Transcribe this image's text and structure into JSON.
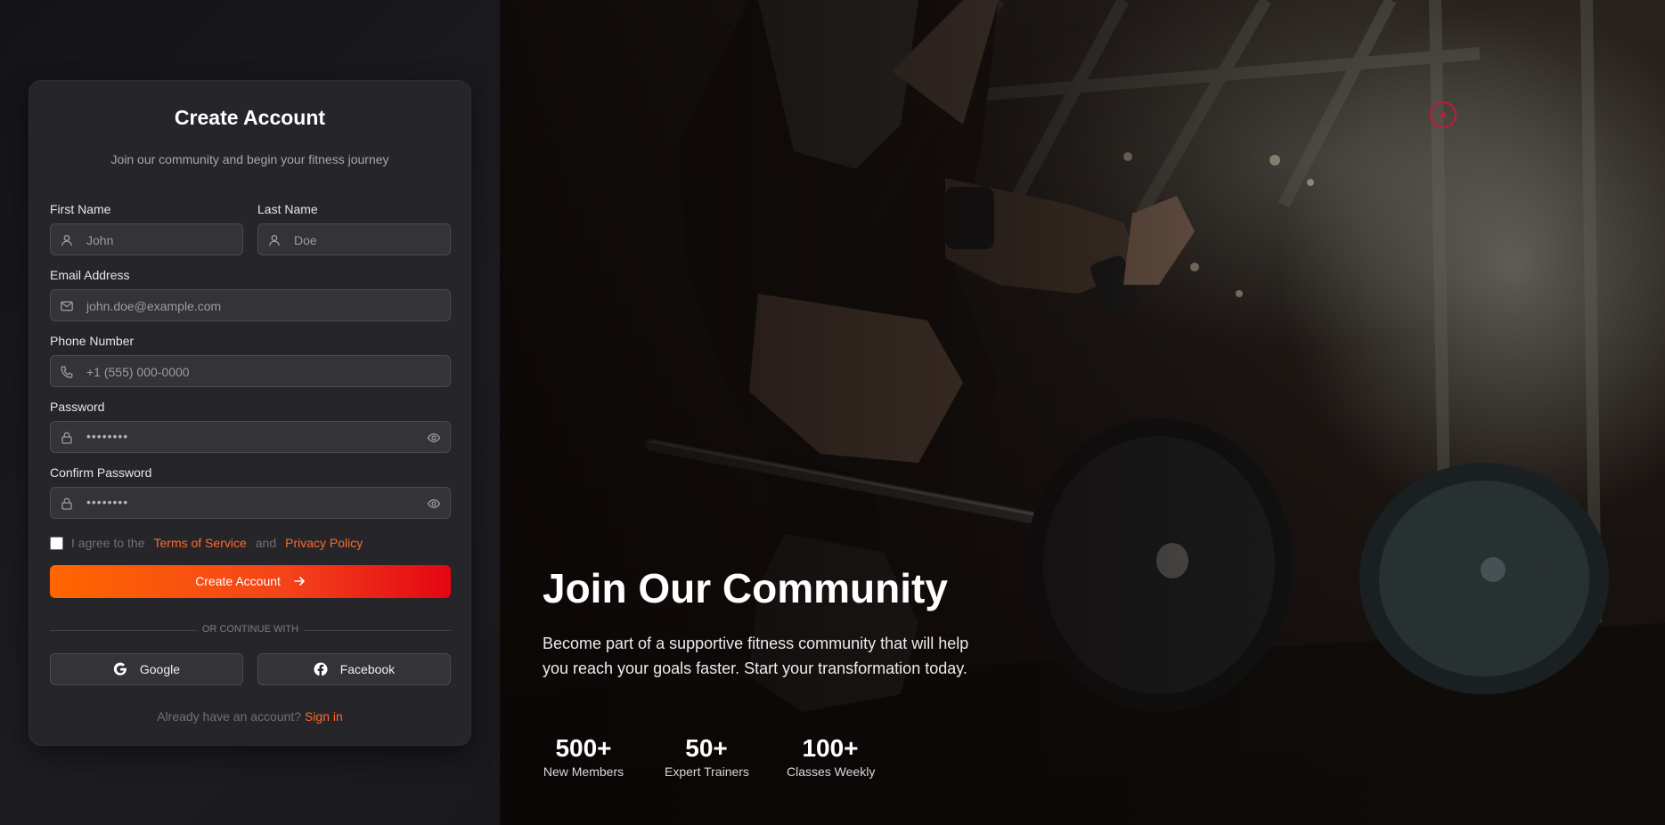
{
  "form": {
    "title": "Create Account",
    "subtitle": "Join our community and begin your fitness journey",
    "first_name": {
      "label": "First Name",
      "placeholder": "John",
      "icon": "user-icon"
    },
    "last_name": {
      "label": "Last Name",
      "placeholder": "Doe",
      "icon": "user-icon"
    },
    "email": {
      "label": "Email Address",
      "placeholder": "john.doe@example.com",
      "icon": "mail-icon"
    },
    "phone": {
      "label": "Phone Number",
      "placeholder": "+1 (555) 000-0000",
      "icon": "phone-icon"
    },
    "password": {
      "label": "Password",
      "value": "••••••••",
      "icon": "lock-icon",
      "toggle_icon": "eye-icon"
    },
    "confirm_password": {
      "label": "Confirm Password",
      "value": "••••••••",
      "icon": "lock-icon",
      "toggle_icon": "eye-icon"
    },
    "agree": {
      "prefix": "I agree to the",
      "terms_link": "Terms of Service",
      "conjunction": "and",
      "privacy_link": "Privacy Policy",
      "checked": false
    },
    "submit_label": "Create Account",
    "divider_text": "OR CONTINUE WITH",
    "social": {
      "google_label": "Google",
      "facebook_label": "Facebook"
    },
    "signin": {
      "prompt": "Already have an account?",
      "link": "Sign in"
    }
  },
  "hero": {
    "title": "Join Our Community",
    "text": "Become part of a supportive fitness community that will help you reach your goals faster. Start your transformation today.",
    "stats": [
      {
        "value": "500+",
        "label": "New Members"
      },
      {
        "value": "50+",
        "label": "Expert Trainers"
      },
      {
        "value": "100+",
        "label": "Classes Weekly"
      }
    ]
  },
  "colors": {
    "accent": "#ff6a2b",
    "button_gradient_start": "#ff6600",
    "button_gradient_end": "#e30613",
    "card_bg": "#26262a",
    "page_bg": "#151518"
  }
}
